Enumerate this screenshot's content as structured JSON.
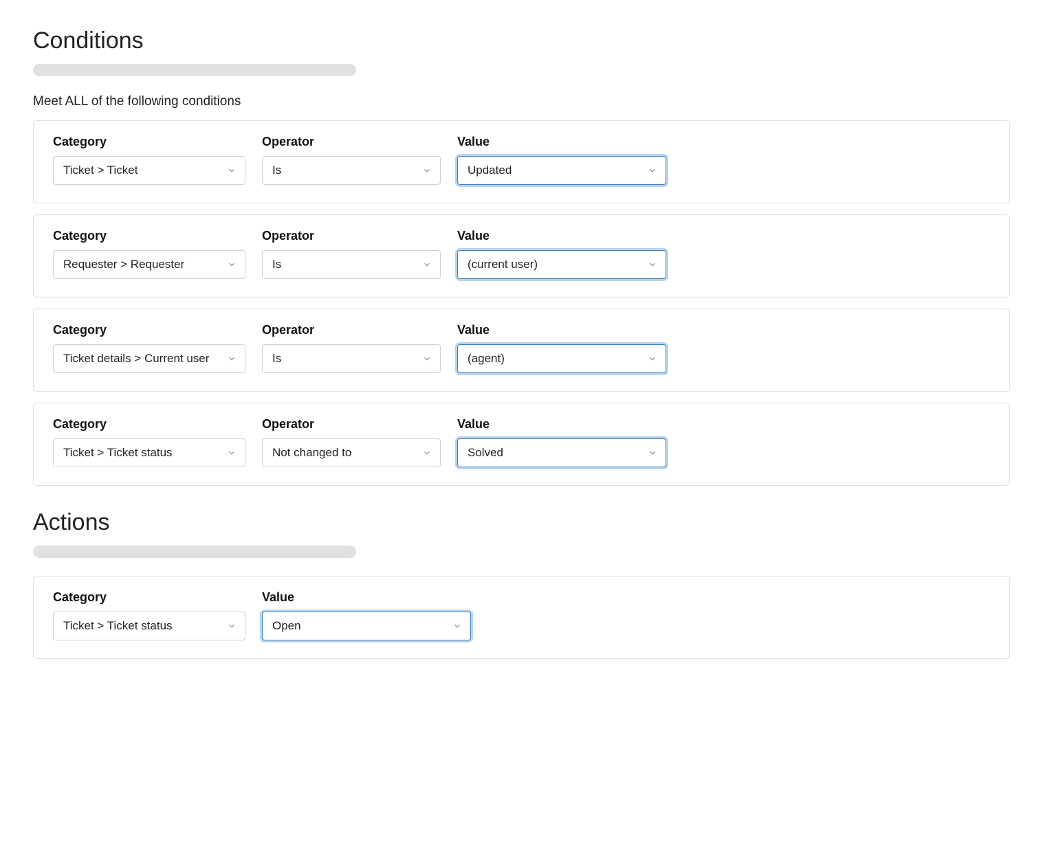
{
  "conditions": {
    "heading": "Conditions",
    "subheading": "Meet ALL of the following conditions",
    "labels": {
      "category": "Category",
      "operator": "Operator",
      "value": "Value"
    },
    "rows": [
      {
        "category": "Ticket > Ticket",
        "operator": "Is",
        "value": "Updated"
      },
      {
        "category": "Requester > Requester",
        "operator": "Is",
        "value": "(current user)"
      },
      {
        "category": "Ticket details > Current user",
        "operator": "Is",
        "value": "(agent)"
      },
      {
        "category": "Ticket > Ticket status",
        "operator": "Not changed to",
        "value": "Solved"
      }
    ]
  },
  "actions": {
    "heading": "Actions",
    "labels": {
      "category": "Category",
      "value": "Value"
    },
    "rows": [
      {
        "category": "Ticket > Ticket status",
        "value": "Open"
      }
    ]
  },
  "colors": {
    "highlightBorder": "#3b82c4",
    "cardBorder": "#e0e0e0",
    "placeholderBar": "#e1e1e1"
  }
}
